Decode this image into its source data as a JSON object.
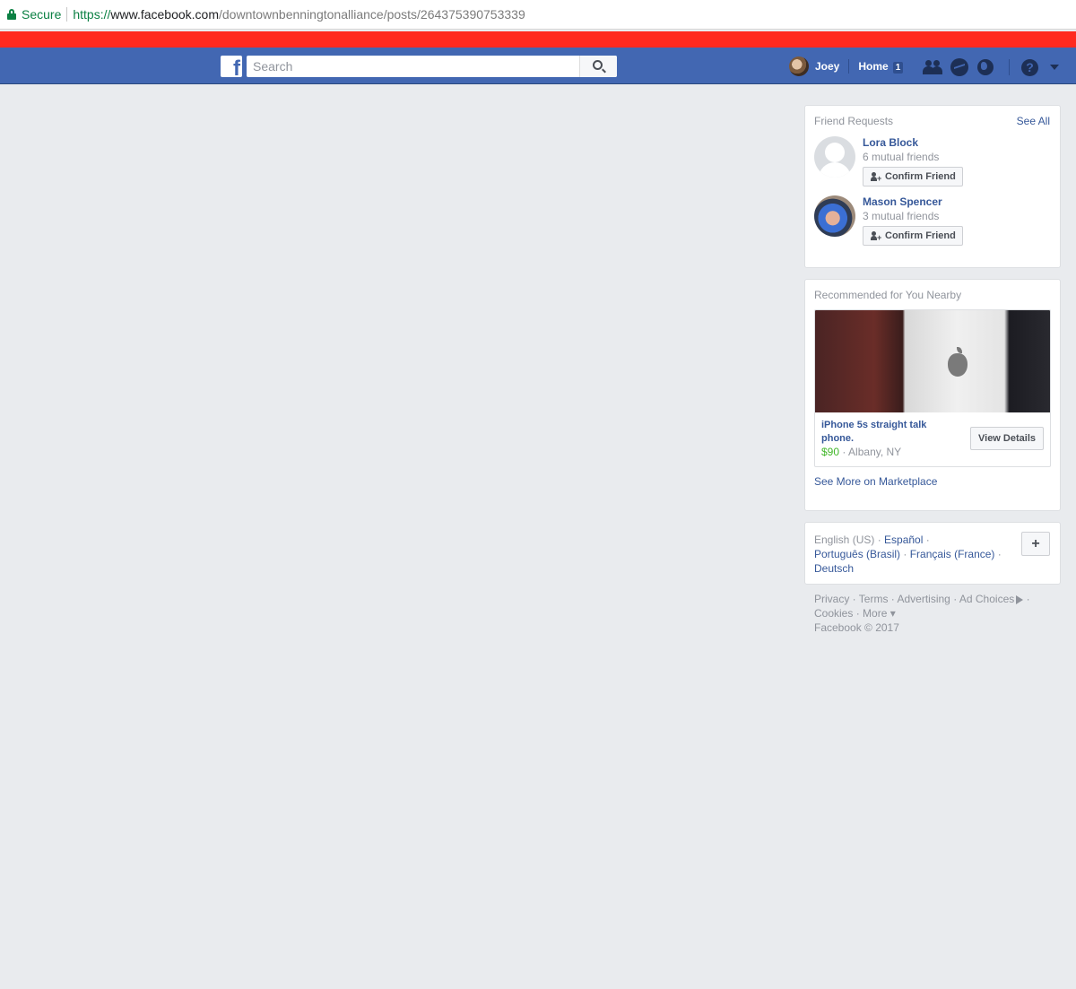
{
  "browser": {
    "secure_label": "Secure",
    "url_scheme": "https://",
    "url_host": "www.facebook.com",
    "url_path": "/downtownbenningtonalliance/posts/264375390753339"
  },
  "bluebar": {
    "logo_letter": "f",
    "search_placeholder": "Search",
    "user_name": "Joey",
    "home_label": "Home",
    "home_count": "1",
    "help_glyph": "?",
    "brand_color": "#4267b2"
  },
  "friend_requests": {
    "title": "Friend Requests",
    "see_all": "See All",
    "items": [
      {
        "name": "Lora Block",
        "mutual": "6 mutual friends",
        "button": "Confirm Friend"
      },
      {
        "name": "Mason Spencer",
        "mutual": "3 mutual friends",
        "button": "Confirm Friend"
      }
    ]
  },
  "recommended": {
    "title": "Recommended for You Nearby",
    "item": {
      "title": "iPhone 5s straight talk phone.",
      "price": "$90",
      "separator": " · ",
      "location": "Albany, NY",
      "button": "View Details"
    },
    "see_more": "See More on Marketplace"
  },
  "languages": {
    "current": "English (US)",
    "options": [
      "Español",
      "Português (Brasil)",
      "Français (France)",
      "Deutsch"
    ],
    "add_label": "+"
  },
  "footer": {
    "links": [
      "Privacy",
      "Terms",
      "Advertising",
      "Ad Choices",
      "Cookies",
      "More"
    ],
    "copyright": "Facebook © 2017"
  }
}
